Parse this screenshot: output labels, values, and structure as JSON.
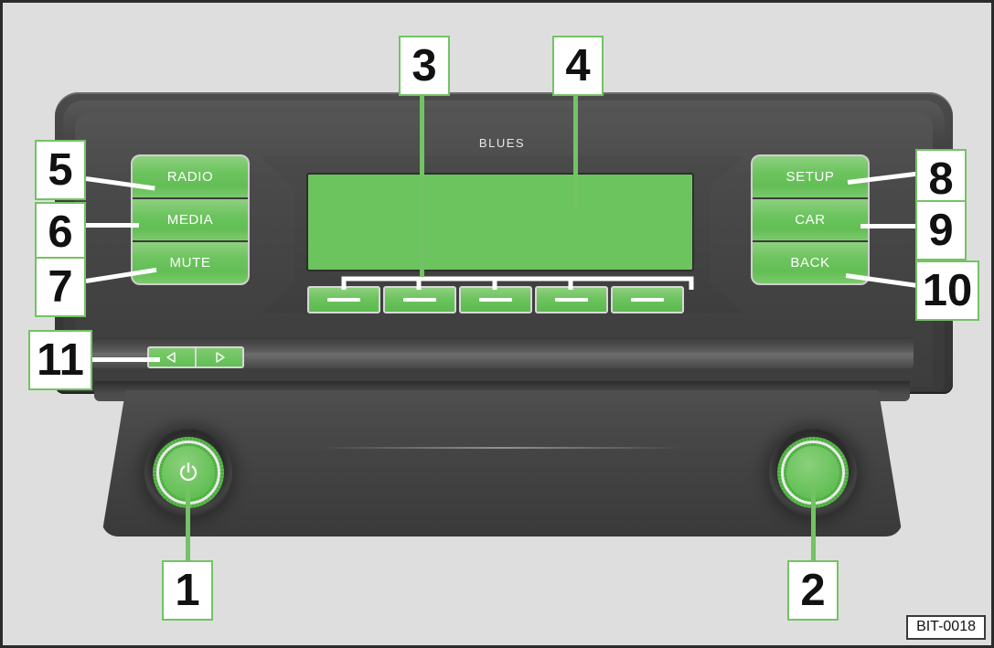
{
  "figure": {
    "code": "BIT-0018",
    "brand": "BLUES"
  },
  "buttons": {
    "left_stack": [
      {
        "label": "RADIO",
        "callout": "5"
      },
      {
        "label": "MEDIA",
        "callout": "6"
      },
      {
        "label": "MUTE",
        "callout": "7"
      }
    ],
    "right_stack": [
      {
        "label": "SETUP",
        "callout": "8"
      },
      {
        "label": "CAR",
        "callout": "9"
      },
      {
        "label": "BACK",
        "callout": "10"
      }
    ],
    "arrows": [
      {
        "icon": "triangle-left-icon",
        "name": "previous-track-button"
      },
      {
        "icon": "triangle-right-icon",
        "name": "next-track-button"
      }
    ]
  },
  "softkeys": {
    "callout": "3",
    "count": 5,
    "labels": [
      "",
      "",
      "",
      "",
      ""
    ]
  },
  "display": {
    "callout": "4",
    "content": ""
  },
  "knobs": [
    {
      "name": "power-volume-knob",
      "callout": "1",
      "icon": "power-icon"
    },
    {
      "name": "menu-tune-knob",
      "callout": "2",
      "icon": ""
    }
  ],
  "callouts": [
    {
      "id": "1",
      "target": "power-volume-knob"
    },
    {
      "id": "2",
      "target": "menu-tune-knob"
    },
    {
      "id": "3",
      "target": "softkey-row"
    },
    {
      "id": "4",
      "target": "display-screen"
    },
    {
      "id": "5",
      "target": "radio-button"
    },
    {
      "id": "6",
      "target": "media-button"
    },
    {
      "id": "7",
      "target": "mute-button"
    },
    {
      "id": "8",
      "target": "setup-button"
    },
    {
      "id": "9",
      "target": "car-button"
    },
    {
      "id": "10",
      "target": "back-button"
    },
    {
      "id": "11",
      "target": "arrow-buttons"
    }
  ],
  "colors": {
    "accent_green": "#6cc45e",
    "callout_border": "#73c364",
    "background": "#dedede",
    "chassis": "#454545"
  }
}
